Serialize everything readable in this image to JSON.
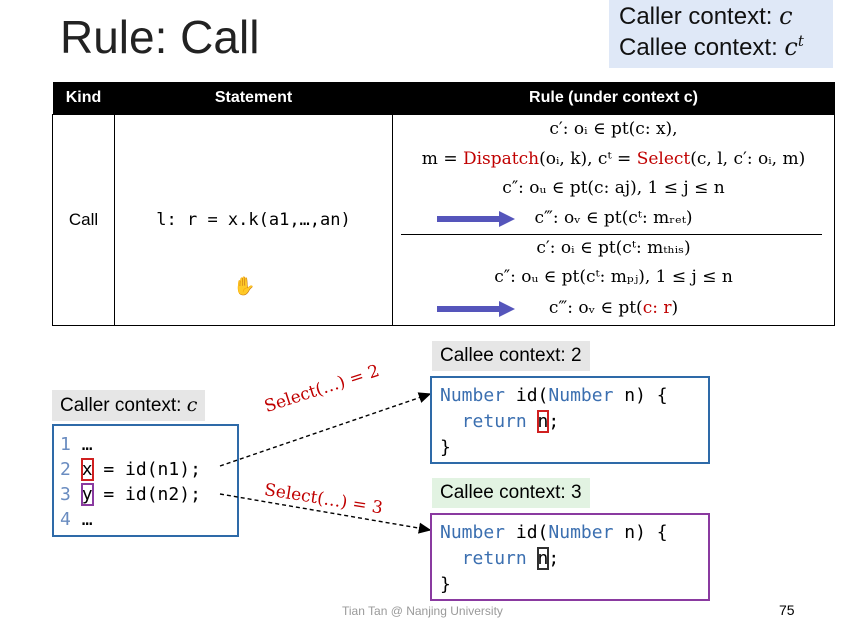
{
  "slide": {
    "title": "Rule: Call",
    "caller_context_label": "Caller context: ",
    "caller_context_var": "c",
    "callee_context_label": "Callee context: ",
    "callee_context_var": "c",
    "callee_context_sup": "t",
    "footer": "Tian Tan @ Nanjing University",
    "page_number": "75"
  },
  "table": {
    "headers": {
      "kind": "Kind",
      "statement": "Statement",
      "rule": "Rule (under context c)"
    },
    "row": {
      "kind": "Call",
      "statement": "l: r = x.k(a1,…,an)",
      "rule_line1": "c′: oᵢ ∈ pt(c: x),",
      "rule_line2_pre": "m = ",
      "rule_line2_dispatch": "Dispatch",
      "rule_line2_mid": "(oᵢ, k), cᵗ = ",
      "rule_line2_select": "Select",
      "rule_line2_post": "(c, l, c′: oᵢ, m)",
      "rule_line3": "c″: oᵤ ∈ pt(c: aj), 1 ≤ j ≤ n",
      "rule_line4": "c‴: oᵥ ∈ pt(cᵗ: mᵣₑₜ)",
      "rule_line5": "c′: oᵢ ∈ pt(cᵗ: mₜₕᵢₛ)",
      "rule_line6": "c″: oᵤ ∈ pt(cᵗ: mₚⱼ), 1 ≤ j ≤ n",
      "rule_line7_pre": "c‴: oᵥ ∈ pt(",
      "rule_line7_ctx": "c: r",
      "rule_line7_post": ")"
    }
  },
  "example": {
    "caller_label": "Caller context: ",
    "caller_var": "c",
    "caller_lines": [
      {
        "num": "1",
        "code": "…"
      },
      {
        "num": "2",
        "var": "x",
        "code": " = id(n1);"
      },
      {
        "num": "3",
        "var": "y",
        "code": " = id(n2);"
      },
      {
        "num": "4",
        "code": "…"
      }
    ],
    "select_label_1": "Select(…) = 2",
    "select_label_2": "Select(…) = 3",
    "callee1_label": "Callee context: 2",
    "callee2_label": "Callee context: 3",
    "callee_code_kw1": "Number",
    "callee_code_sig": " id(",
    "callee_code_kw2": "Number",
    "callee_code_param": " n) {",
    "callee_code_return": "return ",
    "callee_code_var": "n",
    "callee_code_semicolon": ";",
    "callee_code_close": "}"
  },
  "colors": {
    "arrow": "#5555bb",
    "red": "#c00000",
    "callee_box": "#2e6aa8",
    "purple": "#8a3aa0",
    "context_bg": "#dfe8f7"
  }
}
